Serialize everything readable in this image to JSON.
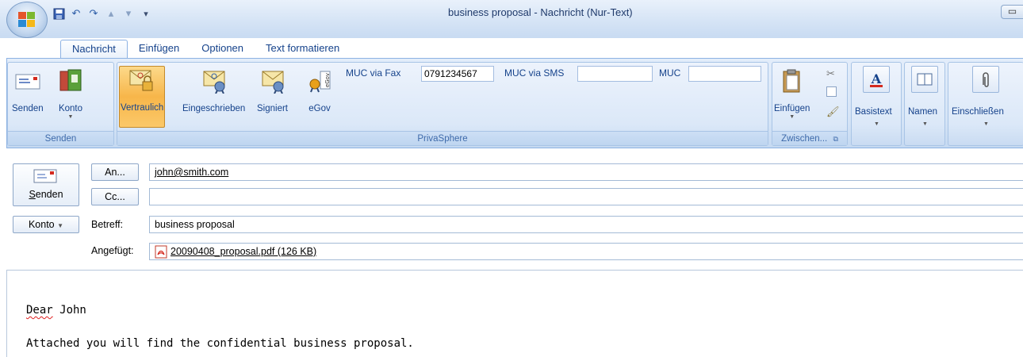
{
  "window": {
    "title": "business proposal - Nachricht (Nur-Text)",
    "restore_glyph": "▭"
  },
  "qat": {
    "icons": [
      "save-icon",
      "undo-icon",
      "redo-icon",
      "up-arrow-icon",
      "down-arrow-icon",
      "customize-icon"
    ]
  },
  "tabs": [
    {
      "label": "Nachricht",
      "active": true
    },
    {
      "label": "Einfügen",
      "active": false
    },
    {
      "label": "Optionen",
      "active": false
    },
    {
      "label": "Text formatieren",
      "active": false
    }
  ],
  "ribbon": {
    "senden_group": {
      "label": "Senden",
      "send_label": "Senden",
      "account_label": "Konto"
    },
    "privasphere_group": {
      "label": "PrivaSphere",
      "confidential_label": "Vertraulich",
      "registered_label": "Eingeschrieben",
      "signed_label": "Signiert",
      "egov_label": "eGov",
      "fax_label": "MUC via Fax",
      "fax_value": "0791234567",
      "sms_label": "MUC via SMS",
      "sms_value": "",
      "muc_label": "MUC",
      "muc_value": ""
    },
    "clipboard_group": {
      "label": "Zwischen...",
      "paste_label": "Einfügen"
    },
    "basic_text_label": "Basistext",
    "names_label": "Namen",
    "include_label": "Einschließen"
  },
  "header": {
    "send_label": "Senden",
    "to_button": "An...",
    "cc_button": "Cc...",
    "account_button": "Konto",
    "subject_label": "Betreff:",
    "attached_label": "Angefügt:",
    "to_value": "john@smith.com",
    "cc_value": "",
    "subject_value": "business proposal",
    "attachment": "20090408_proposal.pdf (126 KB)"
  },
  "body": {
    "greeting_word": "Dear",
    "greeting_name": " John",
    "line2": "Attached you will find the confidential business proposal."
  },
  "colors": {
    "ribbon_blue": "#15428b",
    "pressed_orange": "#f7b64a",
    "pdf_red": "#d42a1f"
  }
}
